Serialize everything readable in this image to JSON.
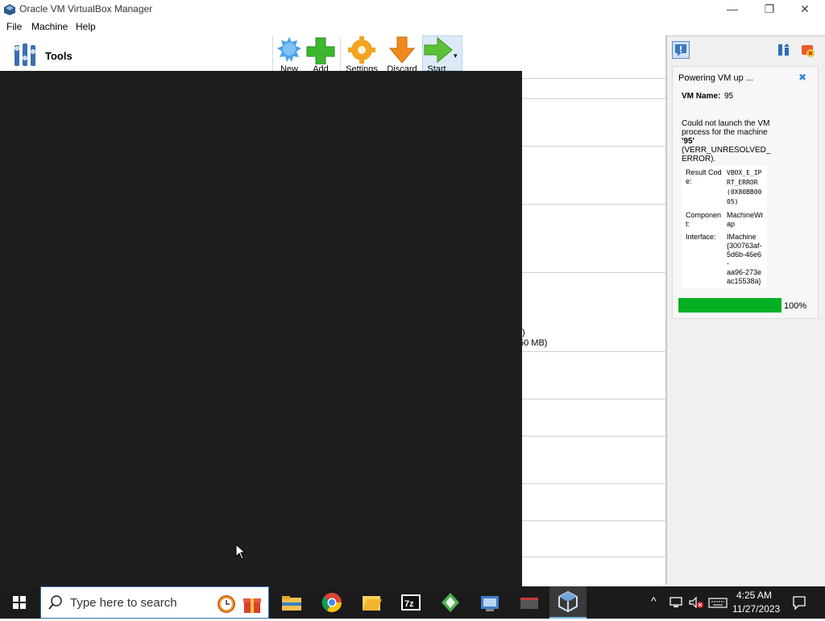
{
  "window": {
    "title": "Oracle VM VirtualBox Manager",
    "minimize": "—",
    "restore": "❐",
    "close": "✕"
  },
  "menu": [
    "File",
    "Machine",
    "Help"
  ],
  "tools_label": "Tools",
  "toolbar": {
    "new": "New",
    "add": "Add",
    "settings": "Settings",
    "discard": "Discard",
    "start": "Start"
  },
  "details_fragments": {
    "paren": ")",
    "mb": "50 MB)"
  },
  "notification": {
    "header": "Powering VM up ...",
    "vm_name_label": "VM Name:",
    "vm_name_value": "95",
    "message_line1": "Could not launch the VM",
    "message_line2": "process for the machine",
    "message_name": "'95'",
    "message_line3": "(VERR_UNRESOLVED_",
    "message_line4": "ERROR).",
    "rows": [
      {
        "label_a": "Result Cod",
        "label_b": "e:",
        "value": [
          "VBOX_E_IP",
          "RT_ERROR",
          "(0X80BB00",
          "05)"
        ]
      },
      {
        "label_a": "Componen",
        "label_b": "t:",
        "value": [
          "MachineWr",
          "ap"
        ]
      },
      {
        "label_a": "Interface:",
        "label_b": "",
        "value": [
          "IMachine",
          "{300763af-",
          "5d6b-46e6",
          "-",
          "aa96-273e",
          "ac15538a}"
        ]
      }
    ],
    "progress_percent": 100,
    "progress_label": "100%"
  },
  "taskbar": {
    "search_placeholder": "Type here to search",
    "time": "4:25 AM",
    "date": "11/27/2023",
    "icons": [
      "windows-start-icon",
      "search-icon",
      "alarm-clock-icon",
      "gift-icon",
      "file-explorer-icon",
      "chrome-icon",
      "folder-app-icon",
      "7zip-icon",
      "network-app-icon",
      "control-panel-icon",
      "terminal-icon",
      "virtualbox-icon"
    ]
  },
  "colors": {
    "progress": "#06b025",
    "overlay": "#1e1e1e",
    "taskbar": "#1b1b1b"
  }
}
